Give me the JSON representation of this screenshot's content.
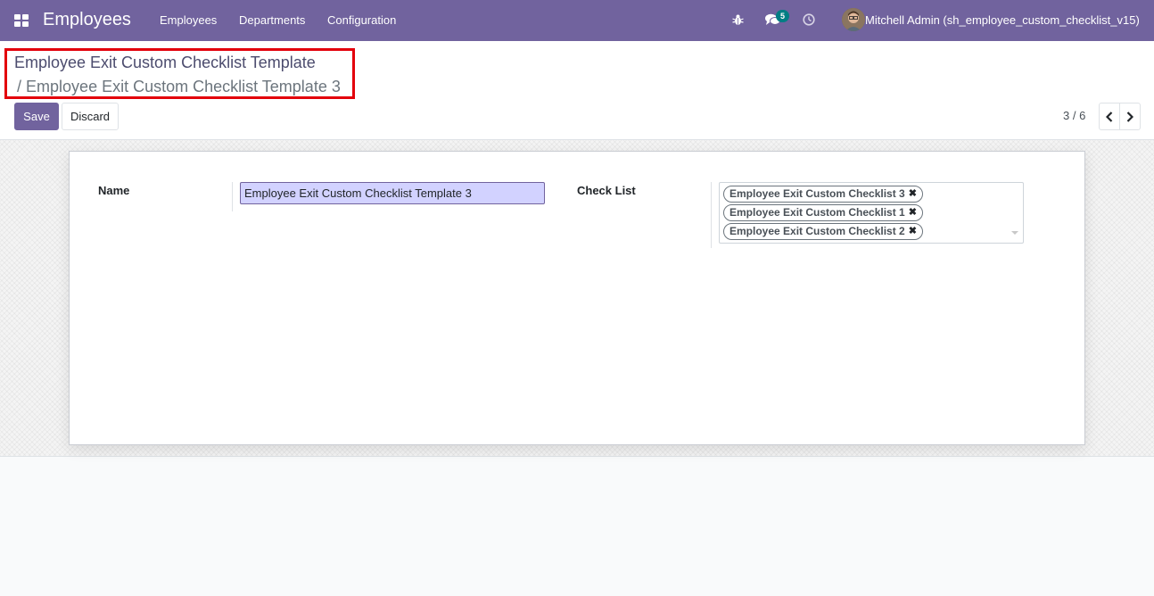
{
  "navbar": {
    "app_title": "Employees",
    "menu": [
      "Employees",
      "Departments",
      "Configuration"
    ],
    "messages_badge": "5",
    "user_name": "Mitchell Admin (sh_employee_custom_checklist_v15)",
    "bg_color": "#71639e",
    "icons": [
      "apps-grid-icon",
      "bug-icon",
      "chat-bubbles-icon",
      "clock-icon"
    ]
  },
  "breadcrumb": {
    "parent": "Employee Exit Custom Checklist Template",
    "separator": "/",
    "current": "Employee Exit Custom Checklist Template 3"
  },
  "buttons": {
    "save": "Save",
    "discard": "Discard"
  },
  "pager": {
    "value": "3 / 6"
  },
  "form": {
    "name_label": "Name",
    "name_value": "Employee Exit Custom Checklist Template 3",
    "checklist_label": "Check List",
    "checklist_tags": [
      "Employee Exit Custom Checklist 3",
      "Employee Exit Custom Checklist 1",
      "Employee Exit Custom Checklist 2"
    ],
    "tag_remove_glyph": "✖"
  },
  "colors": {
    "primary": "#71639e",
    "highlight_border": "#e3000b",
    "badge": "#017e84",
    "input_highlight": "#d2d2ff"
  }
}
